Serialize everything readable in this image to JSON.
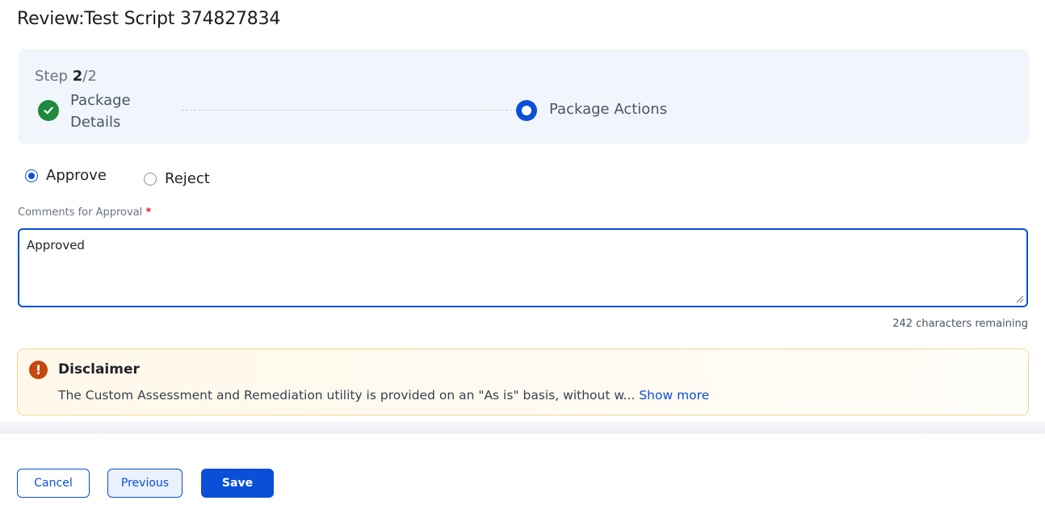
{
  "header": {
    "title": "Review:Test Script 374827834"
  },
  "stepper": {
    "step_prefix": "Step ",
    "current": "2",
    "total": "/2",
    "steps": [
      {
        "label": "Package Details",
        "status": "complete"
      },
      {
        "label": "Package Actions",
        "status": "current"
      }
    ]
  },
  "decision": {
    "options": [
      {
        "label": "Approve",
        "checked": true
      },
      {
        "label": "Reject",
        "checked": false
      }
    ]
  },
  "comments": {
    "label": "Comments for Approval",
    "required_mark": "*",
    "value": "Approved",
    "remaining": "242 characters remaining"
  },
  "disclaimer": {
    "icon": "exclamation-icon",
    "title": "Disclaimer",
    "text": "The Custom Assessment and Remediation utility is provided on an \"As is\" basis, without w...",
    "show_more": "Show more"
  },
  "footer": {
    "cancel_label": "Cancel",
    "previous_label": "Previous",
    "save_label": "Save"
  },
  "colors": {
    "primary": "#0b4fd9",
    "success": "#1f8a3b",
    "warning": "#c5470d",
    "stepper_bg": "#f1f6fd"
  }
}
